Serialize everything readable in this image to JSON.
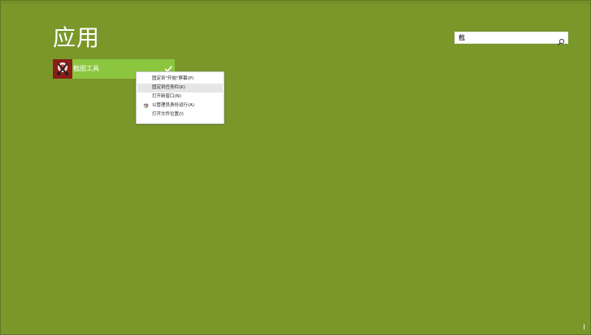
{
  "window": {
    "title": "应用"
  },
  "search": {
    "value": "截",
    "placeholder": ""
  },
  "app_tile": {
    "label": "截图工具",
    "selected": true,
    "accent_color": "#8cc63f",
    "icon": "scissors-app-icon"
  },
  "context_menu": {
    "items": [
      {
        "label": "固定到\"开始\"屏幕(P)",
        "icon": ""
      },
      {
        "label": "固定到任务栏(K)",
        "icon": ""
      },
      {
        "label": "打开新窗口(N)",
        "icon": ""
      },
      {
        "label": "以管理员身份运行(A)",
        "icon": "shield-icon"
      },
      {
        "label": "打开文件位置(I)",
        "icon": ""
      }
    ]
  },
  "colors": {
    "background": "#7a972a",
    "tile": "#8cc63f",
    "menu_highlight": "#e6e6e6"
  }
}
